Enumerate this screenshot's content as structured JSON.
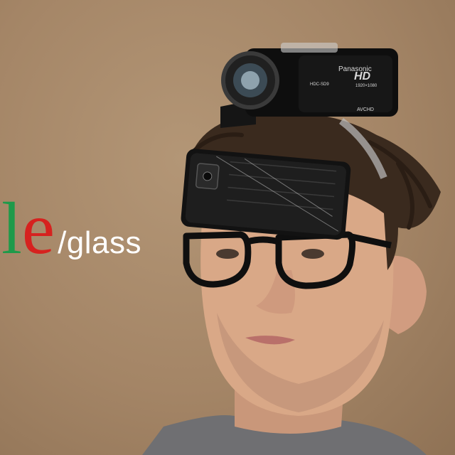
{
  "brand": {
    "logo_partial_1": "l",
    "logo_partial_2": "e",
    "suffix": "/glass",
    "colors": {
      "l": "#1f9a4a",
      "e": "#d6221f",
      "suffix": "#ffffff"
    }
  },
  "camcorder": {
    "brand": "Panasonic",
    "badge": "HD",
    "sub_badge": "1920×1080",
    "model": "HDC-SD9",
    "format": "AVCHD"
  },
  "colors": {
    "background": "#a88b6a",
    "hair": "#3a2a1e",
    "skin": "#d9a887",
    "device_body": "#101010"
  }
}
